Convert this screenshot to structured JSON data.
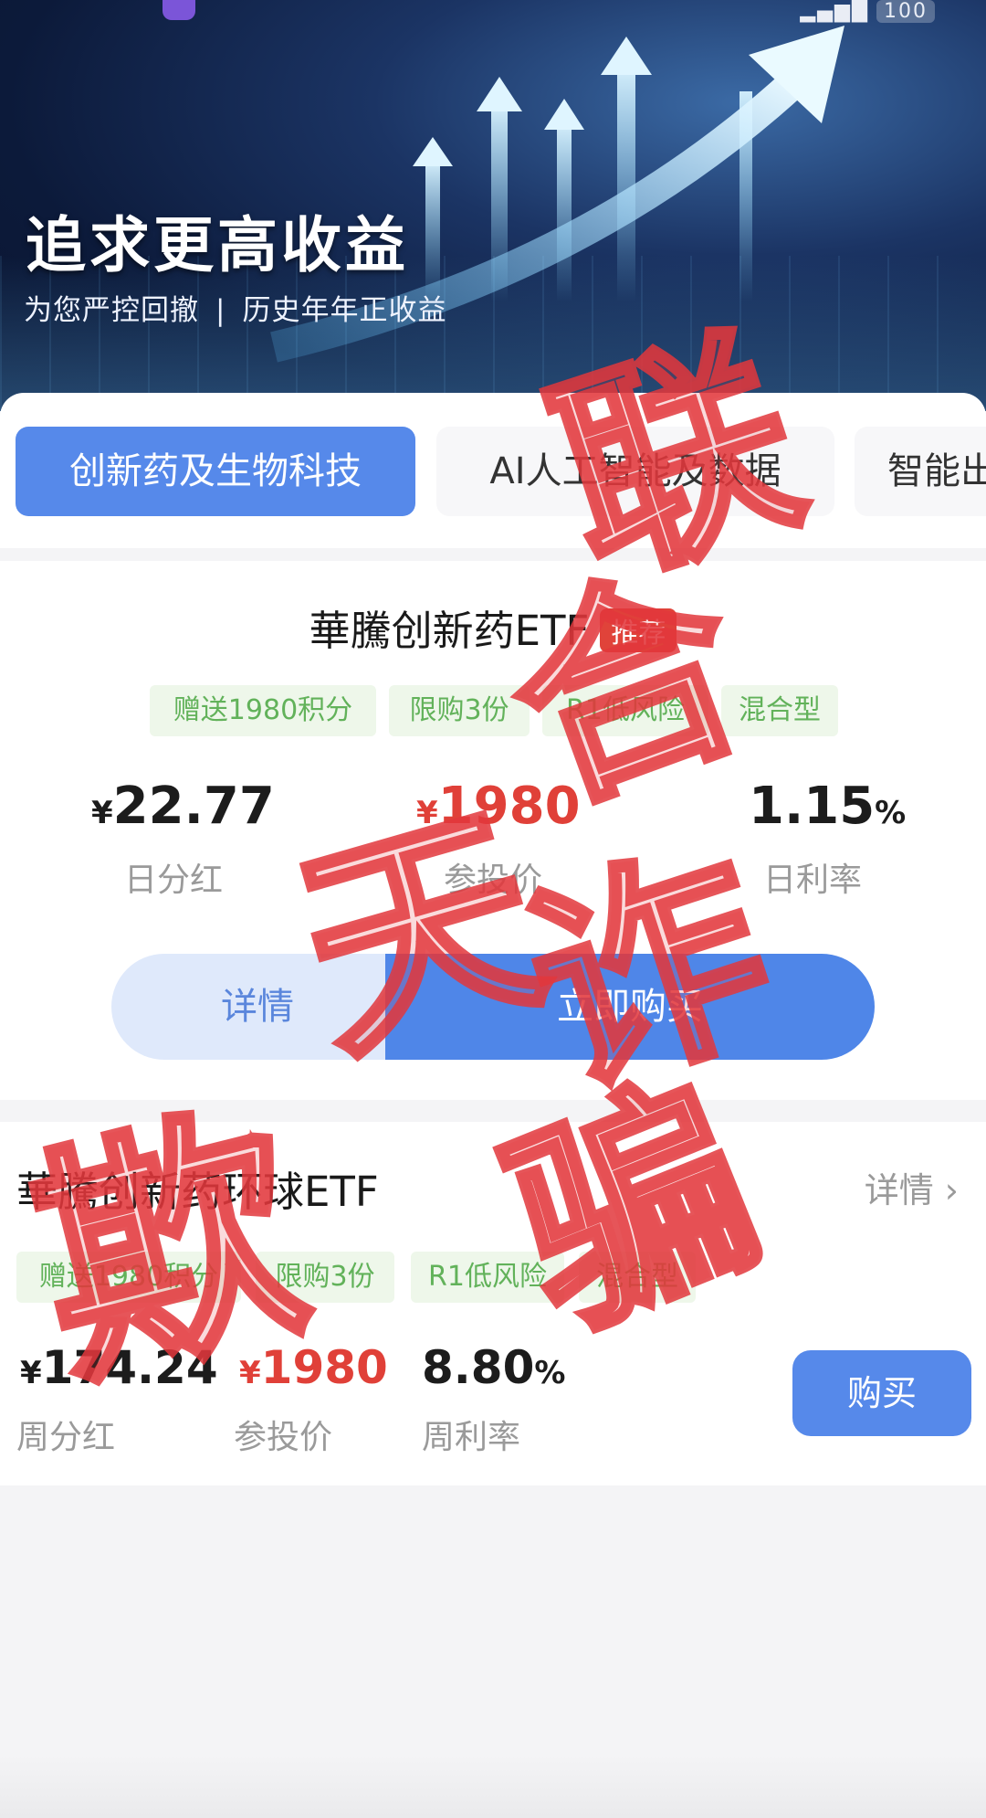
{
  "status_bar": {
    "right_text": "▂▄▆█",
    "battery": "100"
  },
  "hero": {
    "title": "追求更高收益",
    "subtitle_left": "为您严控回撤",
    "subtitle_sep": "|",
    "subtitle_right": "历史年年正收益"
  },
  "tabs": [
    {
      "label": "创新药及生物科技",
      "active": true
    },
    {
      "label": "AI人工智能及数据",
      "active": false
    },
    {
      "label": "智能出",
      "active": false
    }
  ],
  "featured": {
    "title": "華騰创新药ETF",
    "badge": "推荐",
    "tags": [
      "赠送1980积分",
      "限购3份",
      "R1低风险",
      "混合型"
    ],
    "metrics": [
      {
        "currency": "¥",
        "value": "22.77",
        "unit": "",
        "label": "日分红"
      },
      {
        "currency": "¥",
        "value": "1980",
        "unit": "",
        "label": "参投价"
      },
      {
        "currency": "",
        "value": "1.15",
        "unit": "%",
        "label": "日利率"
      }
    ],
    "detail_button": "详情",
    "buy_button": "立即购买"
  },
  "product2": {
    "title": "華騰创新药环球ETF",
    "detail_link": "详情 ›",
    "tags": [
      "赠送1980积分",
      "限购3份",
      "R1低风险",
      "混合型"
    ],
    "metrics": [
      {
        "currency": "¥",
        "value": "174.24",
        "unit": "",
        "label": "周分红"
      },
      {
        "currency": "¥",
        "value": "1980",
        "unit": "",
        "label": "参投价"
      },
      {
        "currency": "",
        "value": "8.80",
        "unit": "%",
        "label": "周利率"
      }
    ],
    "buy_button": "购买"
  },
  "stamp": {
    "line1": "联合",
    "line2": "诈骗",
    "line3": "欺",
    "line4": "天"
  },
  "colors": {
    "primary_blue": "#5689ea",
    "red": "#e04038",
    "tag_green": "#62b25a",
    "stamp_red": "#e2373c"
  }
}
